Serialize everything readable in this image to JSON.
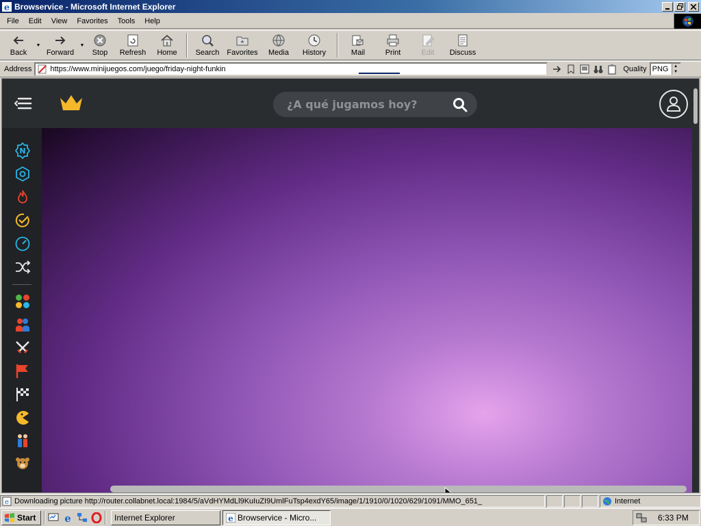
{
  "window": {
    "title": "Browservice - Microsoft Internet Explorer",
    "buttons": [
      "minimize",
      "restore",
      "close"
    ]
  },
  "menubar": {
    "items": [
      "File",
      "Edit",
      "View",
      "Favorites",
      "Tools",
      "Help"
    ]
  },
  "toolbar": {
    "back": "Back",
    "forward": "Forward",
    "stop": "Stop",
    "refresh": "Refresh",
    "home": "Home",
    "search": "Search",
    "favorites": "Favorites",
    "media": "Media",
    "history": "History",
    "mail": "Mail",
    "print": "Print",
    "edit": "Edit",
    "discuss": "Discuss"
  },
  "addressbar": {
    "label": "Address",
    "url": "https://www.minijuegos.com/juego/friday-night-funkin",
    "quality_label": "Quality",
    "quality_value": "PNG"
  },
  "page": {
    "search_placeholder": "¿A qué jugamos hoy?",
    "accent_color": "#f4b82a",
    "sidebar_icons": [
      "new-icon",
      "hexagon-icon",
      "fire-icon",
      "check-circle-icon",
      "speedometer-icon",
      "shuffle-icon",
      "color-dots-icon",
      "two-players-icon",
      "swords-icon",
      "flag-icon",
      "racing-flag-icon",
      "pacman-icon",
      "kids-icon",
      "teddy-bear-icon"
    ]
  },
  "statusbar": {
    "message": "Downloading picture http://router.collabnet.local:1984/5/aVdHYMdLl9KuIuZI9UmlFuTsp4exdY65/image/1/1910/0/1020/629/1091/MMO_651_",
    "zone": "Internet"
  },
  "taskbar": {
    "start": "Start",
    "tasks": [
      "Internet Explorer",
      "Browservice - Micro..."
    ],
    "clock": "6:33 PM"
  }
}
